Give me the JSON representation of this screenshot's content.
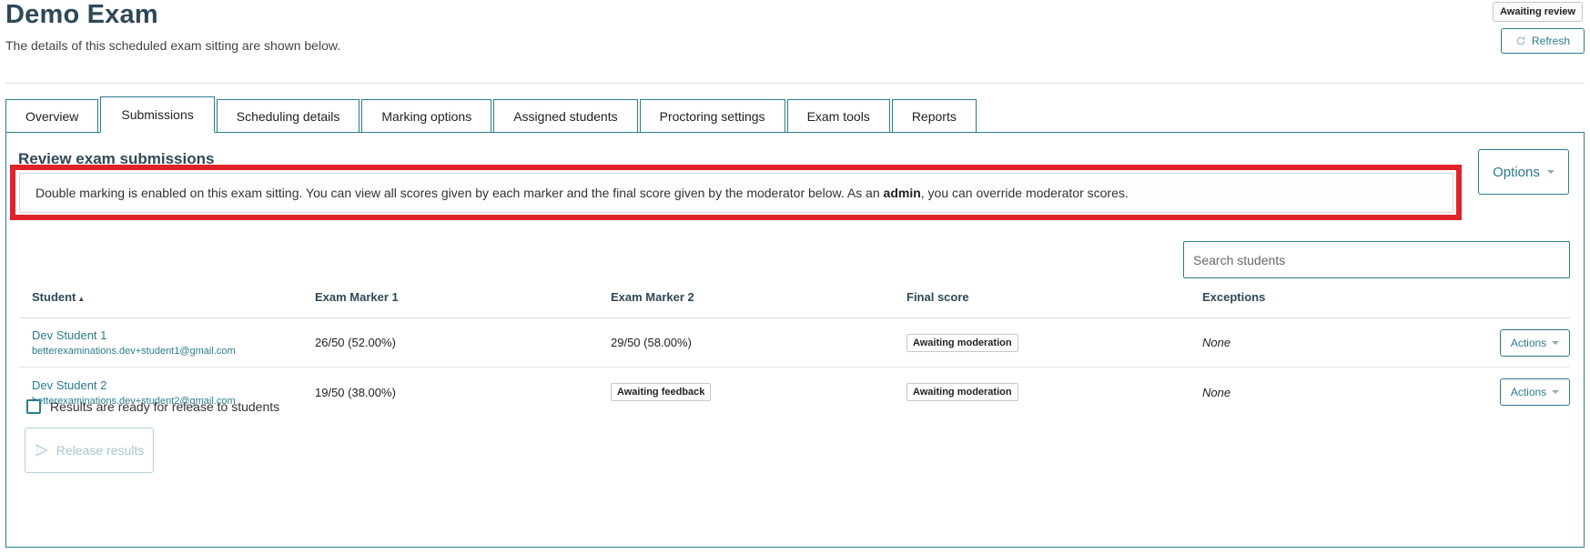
{
  "header": {
    "title": "Demo Exam",
    "subtitle": "The details of this scheduled exam sitting are shown below.",
    "status_badge": "Awaiting review",
    "refresh_label": "Refresh"
  },
  "tabs": [
    {
      "label": "Overview"
    },
    {
      "label": "Submissions",
      "active": true
    },
    {
      "label": "Scheduling details"
    },
    {
      "label": "Marking options"
    },
    {
      "label": "Assigned students"
    },
    {
      "label": "Proctoring settings"
    },
    {
      "label": "Exam tools"
    },
    {
      "label": "Reports"
    }
  ],
  "submissions": {
    "title": "Review exam submissions",
    "alert_before": "Double marking is enabled on this exam sitting. You can view all scores given by each marker and the final score given by the moderator below. As an ",
    "alert_bold": "admin",
    "alert_after": ", you can override moderator scores.",
    "options_label": "Options",
    "search_placeholder": "Search students",
    "columns": {
      "student": "Student",
      "marker1": "Exam Marker 1",
      "marker2": "Exam Marker 2",
      "final": "Final score",
      "exceptions": "Exceptions"
    },
    "rows": [
      {
        "name": "Dev Student 1",
        "email": "betterexaminations.dev+student1@gmail.com",
        "marker1": "26/50 (52.00%)",
        "marker2": "29/50 (58.00%)",
        "final": "Awaiting moderation",
        "exceptions": "None",
        "actions": "Actions"
      },
      {
        "name": "Dev Student 2",
        "email": "betterexaminations.dev+student2@gmail.com",
        "marker1": "19/50 (38.00%)",
        "marker2": "Awaiting feedback",
        "final": "Awaiting moderation",
        "exceptions": "None",
        "actions": "Actions"
      }
    ],
    "release_checkbox_label": "Results are ready for release to students",
    "release_button_label": "Release results"
  },
  "colors": {
    "accent": "#2a7c8c",
    "title": "#2f4858",
    "highlight": "#e0232a"
  }
}
